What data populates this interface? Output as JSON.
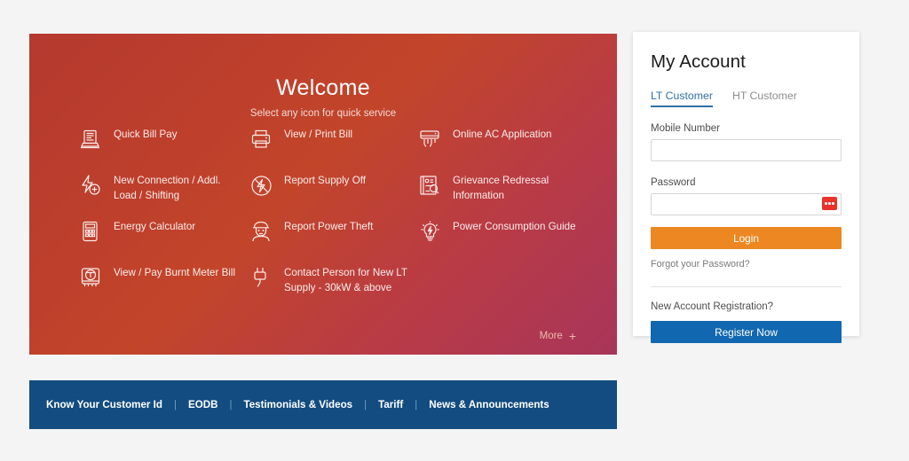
{
  "hero": {
    "title": "Welcome",
    "subtitle": "Select any icon for quick service",
    "more_label": "More",
    "more_plus": "+",
    "gradient_start": "#b5392f",
    "gradient_mid": "#c2452a",
    "gradient_end": "#a8355a",
    "services": [
      {
        "label": "Quick Bill Pay",
        "icon": "bill-laptop-icon"
      },
      {
        "label": "View / Print Bill",
        "icon": "printer-icon"
      },
      {
        "label": "Online AC Application",
        "icon": "air-conditioner-icon"
      },
      {
        "label": "New Connection / Addl. Load / Shifting",
        "icon": "bolt-plus-icon"
      },
      {
        "label": "Report Supply Off",
        "icon": "bolt-crossed-icon"
      },
      {
        "label": "Grievance Redressal Information",
        "icon": "document-search-icon"
      },
      {
        "label": "Energy Calculator",
        "icon": "calculator-icon"
      },
      {
        "label": "Report Power Theft",
        "icon": "worker-helmet-icon"
      },
      {
        "label": "Power Consumption Guide",
        "icon": "bulb-bolt-icon"
      },
      {
        "label": "View / Pay Burnt Meter Bill",
        "icon": "electric-meter-icon"
      },
      {
        "label": "Contact Person for New LT Supply - 30kW & above",
        "icon": "plug-icon"
      }
    ]
  },
  "account": {
    "title": "My Account",
    "tabs": [
      {
        "label": "LT Customer",
        "active": true
      },
      {
        "label": "HT Customer",
        "active": false
      }
    ],
    "mobile_label": "Mobile Number",
    "mobile_value": "",
    "mobile_placeholder": "",
    "password_label": "Password",
    "password_value": "",
    "password_placeholder": "",
    "keyboard_icon": "virtual-keyboard-icon",
    "login_label": "Login",
    "forgot_label": "Forgot your Password?",
    "register_text": "New Account Registration?",
    "register_label": "Register Now",
    "accent_login": "#ec8722",
    "accent_register": "#1168b0",
    "accent_tab": "#2f6fa8"
  },
  "bottom_nav": {
    "background": "#124c80",
    "separator": "|",
    "links": [
      {
        "label": "Know Your Customer Id"
      },
      {
        "label": "EODB"
      },
      {
        "label": "Testimonials & Videos"
      },
      {
        "label": "Tariff"
      },
      {
        "label": "News & Announcements"
      }
    ]
  }
}
